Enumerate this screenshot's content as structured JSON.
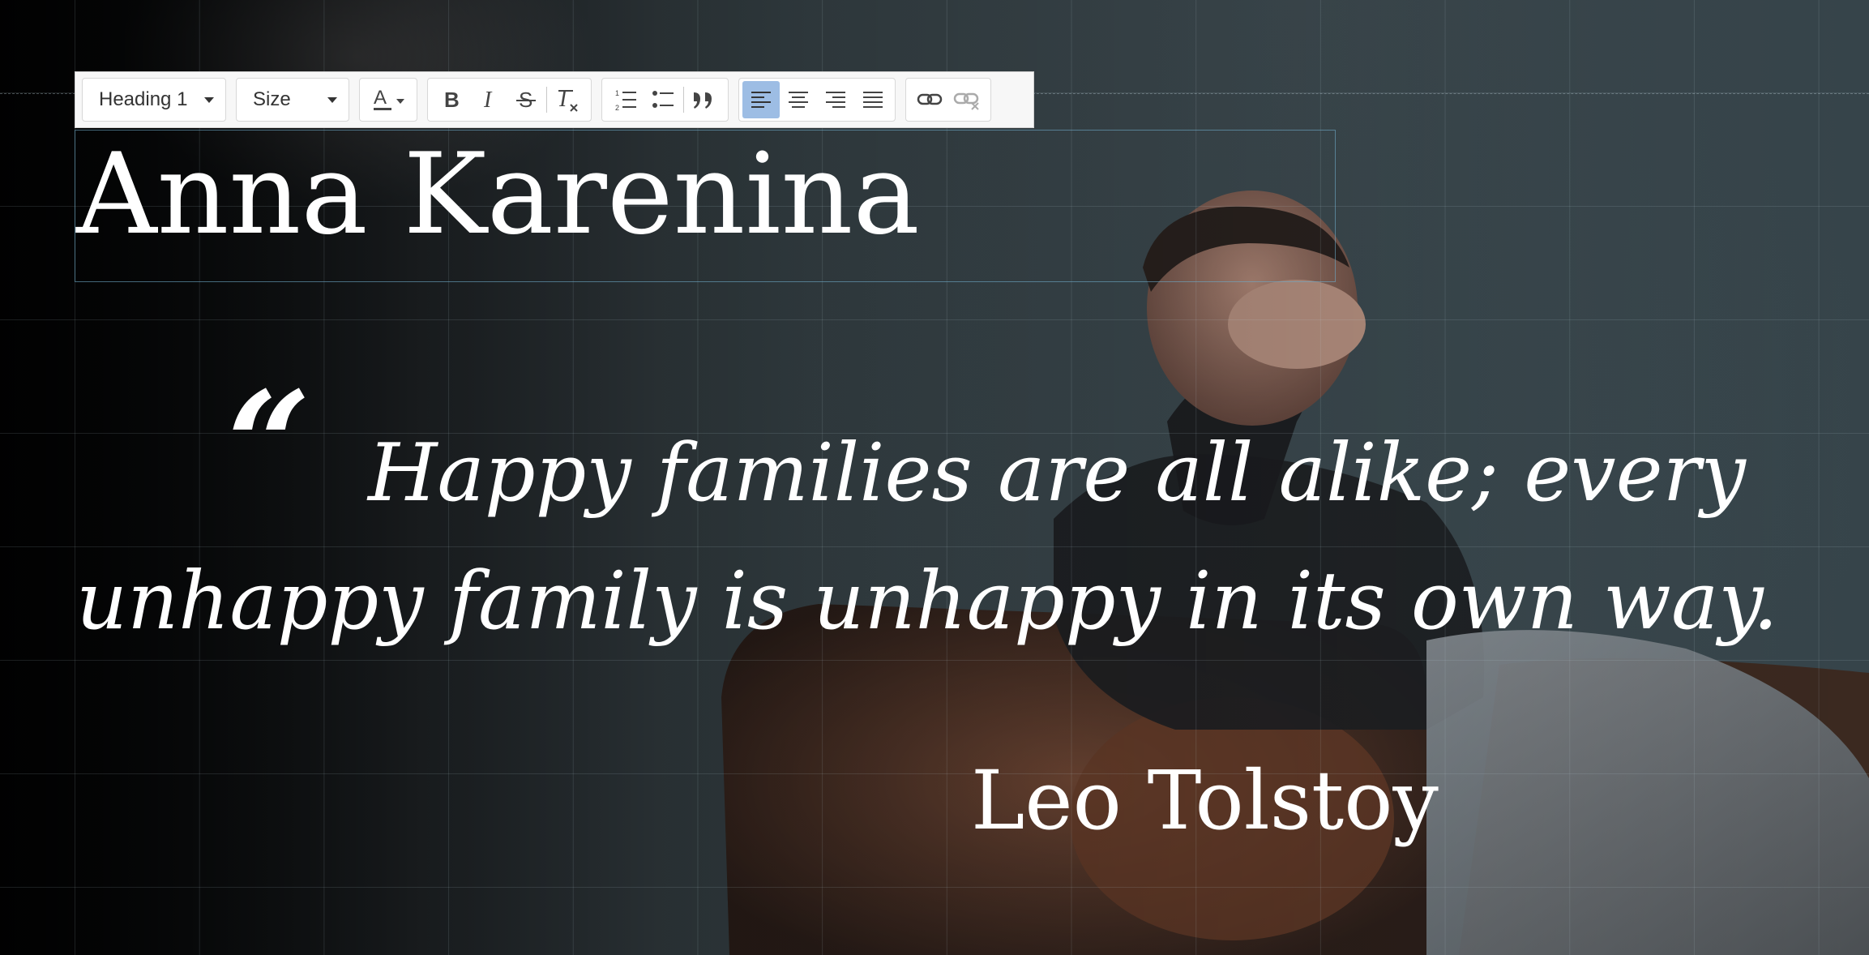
{
  "toolbar": {
    "format_select": {
      "value": "Heading 1"
    },
    "size_select": {
      "value": "Size"
    },
    "buttons": {
      "text_color": {
        "label": "A",
        "icon": "font-color-icon"
      },
      "bold": {
        "label": "B",
        "icon": "bold-icon"
      },
      "italic": {
        "label": "I",
        "icon": "italic-icon"
      },
      "strikethrough": {
        "label": "S",
        "icon": "strikethrough-icon"
      },
      "remove_format": {
        "label": "I",
        "icon": "remove-format-icon"
      },
      "numbered_list": {
        "icon": "numbered-list-icon"
      },
      "bulleted_list": {
        "icon": "bulleted-list-icon"
      },
      "blockquote": {
        "label": "”",
        "icon": "blockquote-icon"
      },
      "align_left": {
        "icon": "align-left-icon",
        "active": true
      },
      "align_center": {
        "icon": "align-center-icon"
      },
      "align_right": {
        "icon": "align-right-icon"
      },
      "justify": {
        "icon": "align-justify-icon"
      },
      "link": {
        "icon": "link-icon"
      },
      "unlink": {
        "icon": "unlink-icon"
      }
    },
    "active_color": "#9dbde4"
  },
  "content": {
    "heading": "Anna Karenina",
    "quote_mark": "“",
    "quote_line1": "Happy families are all alike; every",
    "quote_line2": "unhappy family is unhappy in its own way.",
    "author": "Leo Tolstoy"
  }
}
